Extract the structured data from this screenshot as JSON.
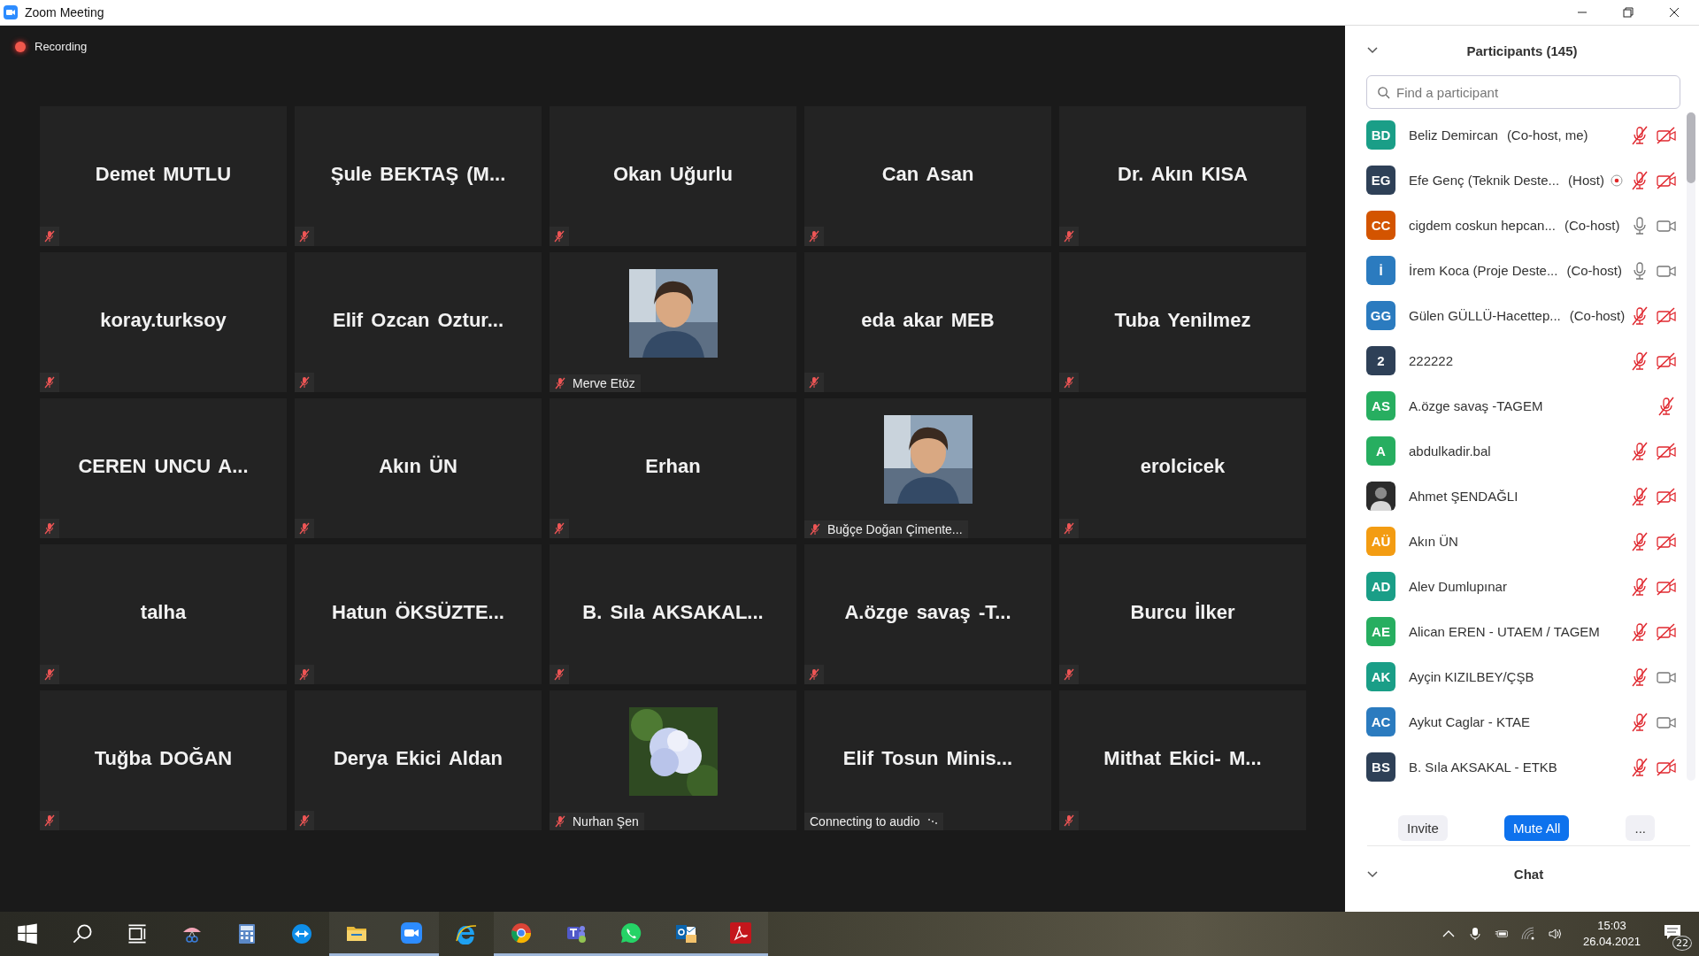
{
  "window": {
    "title": "Zoom Meeting"
  },
  "recording": {
    "label": "Recording",
    "on": true
  },
  "tiles": [
    {
      "kind": "name",
      "name": "Demet MUTLU",
      "muted": true
    },
    {
      "kind": "name",
      "name": "Şule BEKTAŞ (M...",
      "muted": true
    },
    {
      "kind": "name",
      "name": "Okan Uğurlu",
      "muted": true
    },
    {
      "kind": "name",
      "name": "Can Asan",
      "muted": true
    },
    {
      "kind": "name",
      "name": "Dr. Akın KISA",
      "muted": true
    },
    {
      "kind": "name",
      "name": "koray.turksoy",
      "muted": true
    },
    {
      "kind": "name",
      "name": "Elif Ozcan Oztur...",
      "muted": true
    },
    {
      "kind": "portrait",
      "name": "Merve Etöz",
      "muted": true
    },
    {
      "kind": "name",
      "name": "eda akar MEB",
      "muted": true
    },
    {
      "kind": "name",
      "name": "Tuba Yenilmez",
      "muted": true
    },
    {
      "kind": "name",
      "name": "CEREN UNCU A...",
      "muted": true
    },
    {
      "kind": "name",
      "name": "Akın ÜN",
      "muted": true
    },
    {
      "kind": "name",
      "name": "Erhan",
      "muted": true
    },
    {
      "kind": "portrait",
      "name": "Buğçe Doğan Çimente...",
      "muted": true
    },
    {
      "kind": "name",
      "name": "erolcicek",
      "muted": true
    },
    {
      "kind": "name",
      "name": "talha",
      "muted": true
    },
    {
      "kind": "name",
      "name": "Hatun ÖKSÜZTE...",
      "muted": true
    },
    {
      "kind": "name",
      "name": "B. Sıla AKSAKAL...",
      "muted": true
    },
    {
      "kind": "name",
      "name": "A.özge savaş -T...",
      "muted": true
    },
    {
      "kind": "name",
      "name": "Burcu İlker",
      "muted": true
    },
    {
      "kind": "name",
      "name": "Tuğba DOĞAN",
      "muted": true
    },
    {
      "kind": "name",
      "name": "Derya Ekici Aldan",
      "muted": true
    },
    {
      "kind": "flower",
      "name": "Nurhan Şen",
      "muted": true
    },
    {
      "kind": "connecting",
      "name": "Elif Tosun Minis...",
      "status": "Connecting to audio"
    },
    {
      "kind": "name",
      "name": "Mithat Ekici- M...",
      "muted": true
    }
  ],
  "participants_panel": {
    "title": "Participants (145)",
    "search": {
      "placeholder": "Find a participant"
    },
    "participants": [
      {
        "kind": "initials",
        "initials": "BD",
        "color": "#1a9e87",
        "name": "Beliz Demircan",
        "role": "(Co-host, me)",
        "recording": false,
        "muted": true,
        "video_on": false
      },
      {
        "kind": "initials",
        "initials": "EG",
        "color": "#2e4057",
        "name": "Efe Genç (Teknik Deste...",
        "role": "(Host)",
        "recording": true,
        "muted": true,
        "video_on": false
      },
      {
        "kind": "initials",
        "initials": "CC",
        "color": "#d35400",
        "name": "cigdem coskun hepcan...",
        "role": "(Co-host)",
        "recording": false,
        "muted": false,
        "video_on": true
      },
      {
        "kind": "initials",
        "initials": "İ",
        "color": "#2b7bbf",
        "name": "İrem Koca (Proje Deste...",
        "role": "(Co-host)",
        "recording": false,
        "muted": false,
        "video_on": true
      },
      {
        "kind": "initials",
        "initials": "GG",
        "color": "#2b7bbf",
        "name": "Gülen GÜLLÜ-Hacettep...",
        "role": "(Co-host)",
        "recording": false,
        "muted": true,
        "video_on": false
      },
      {
        "kind": "initials",
        "initials": "2",
        "color": "#2e4057",
        "name": "222222",
        "recording": false,
        "muted": true,
        "video_on": false
      },
      {
        "kind": "initials",
        "initials": "AS",
        "color": "#27ae60",
        "name": "A.özge savaş -TAGEM",
        "recording": false,
        "muted": true
      },
      {
        "kind": "initials",
        "initials": "A",
        "color": "#27ae60",
        "name": "abdulkadir.bal",
        "recording": false,
        "muted": true,
        "video_on": false
      },
      {
        "kind": "picture",
        "name": "Ahmet ŞENDAĞLI",
        "recording": false,
        "muted": true,
        "video_on": false
      },
      {
        "kind": "initials",
        "initials": "AÜ",
        "color": "#f39c12",
        "name": "Akın ÜN",
        "recording": false,
        "muted": true,
        "video_on": false
      },
      {
        "kind": "initials",
        "initials": "AD",
        "color": "#1a9e87",
        "name": "Alev Dumlupınar",
        "recording": false,
        "muted": true,
        "video_on": false
      },
      {
        "kind": "initials",
        "initials": "AE",
        "color": "#27ae60",
        "name": "Alican EREN - UTAEM / TAGEM",
        "recording": false,
        "muted": true,
        "video_on": false
      },
      {
        "kind": "initials",
        "initials": "AK",
        "color": "#1a9e87",
        "name": "Ayçin KIZILBEY/ÇŞB",
        "recording": false,
        "muted": true,
        "video_on": true
      },
      {
        "kind": "initials",
        "initials": "AC",
        "color": "#2b7bbf",
        "name": "Aykut Caglar - KTAE",
        "recording": false,
        "muted": true,
        "video_on": true
      },
      {
        "kind": "initials",
        "initials": "BS",
        "color": "#2e4057",
        "name": "B. Sıla AKSAKAL - ETKB",
        "recording": false,
        "muted": true,
        "video_on": false
      }
    ],
    "buttons": [
      {
        "label": "Invite",
        "kind": "plain"
      },
      {
        "label": "Mute All",
        "kind": "primary"
      },
      {
        "label": "...",
        "kind": "plain"
      }
    ]
  },
  "chat": {
    "title": "Chat"
  },
  "taskbar": {
    "apps": [
      {
        "kind": "start",
        "active": false
      },
      {
        "kind": "search",
        "active": false
      },
      {
        "kind": "taskview",
        "active": false
      },
      {
        "kind": "snip",
        "active": false
      },
      {
        "kind": "calculator",
        "active": false
      },
      {
        "kind": "remote",
        "active": false
      },
      {
        "kind": "folder",
        "active": true
      },
      {
        "kind": "video",
        "active": true
      },
      {
        "kind": "browser-e",
        "active": false
      },
      {
        "kind": "browser-c",
        "active": true
      },
      {
        "kind": "teams",
        "active": true
      },
      {
        "kind": "phone",
        "active": true
      },
      {
        "kind": "mail",
        "active": true
      },
      {
        "kind": "pdf",
        "active": true
      }
    ],
    "time": "15:03",
    "date": "26.04.2021",
    "notifications": "22"
  }
}
